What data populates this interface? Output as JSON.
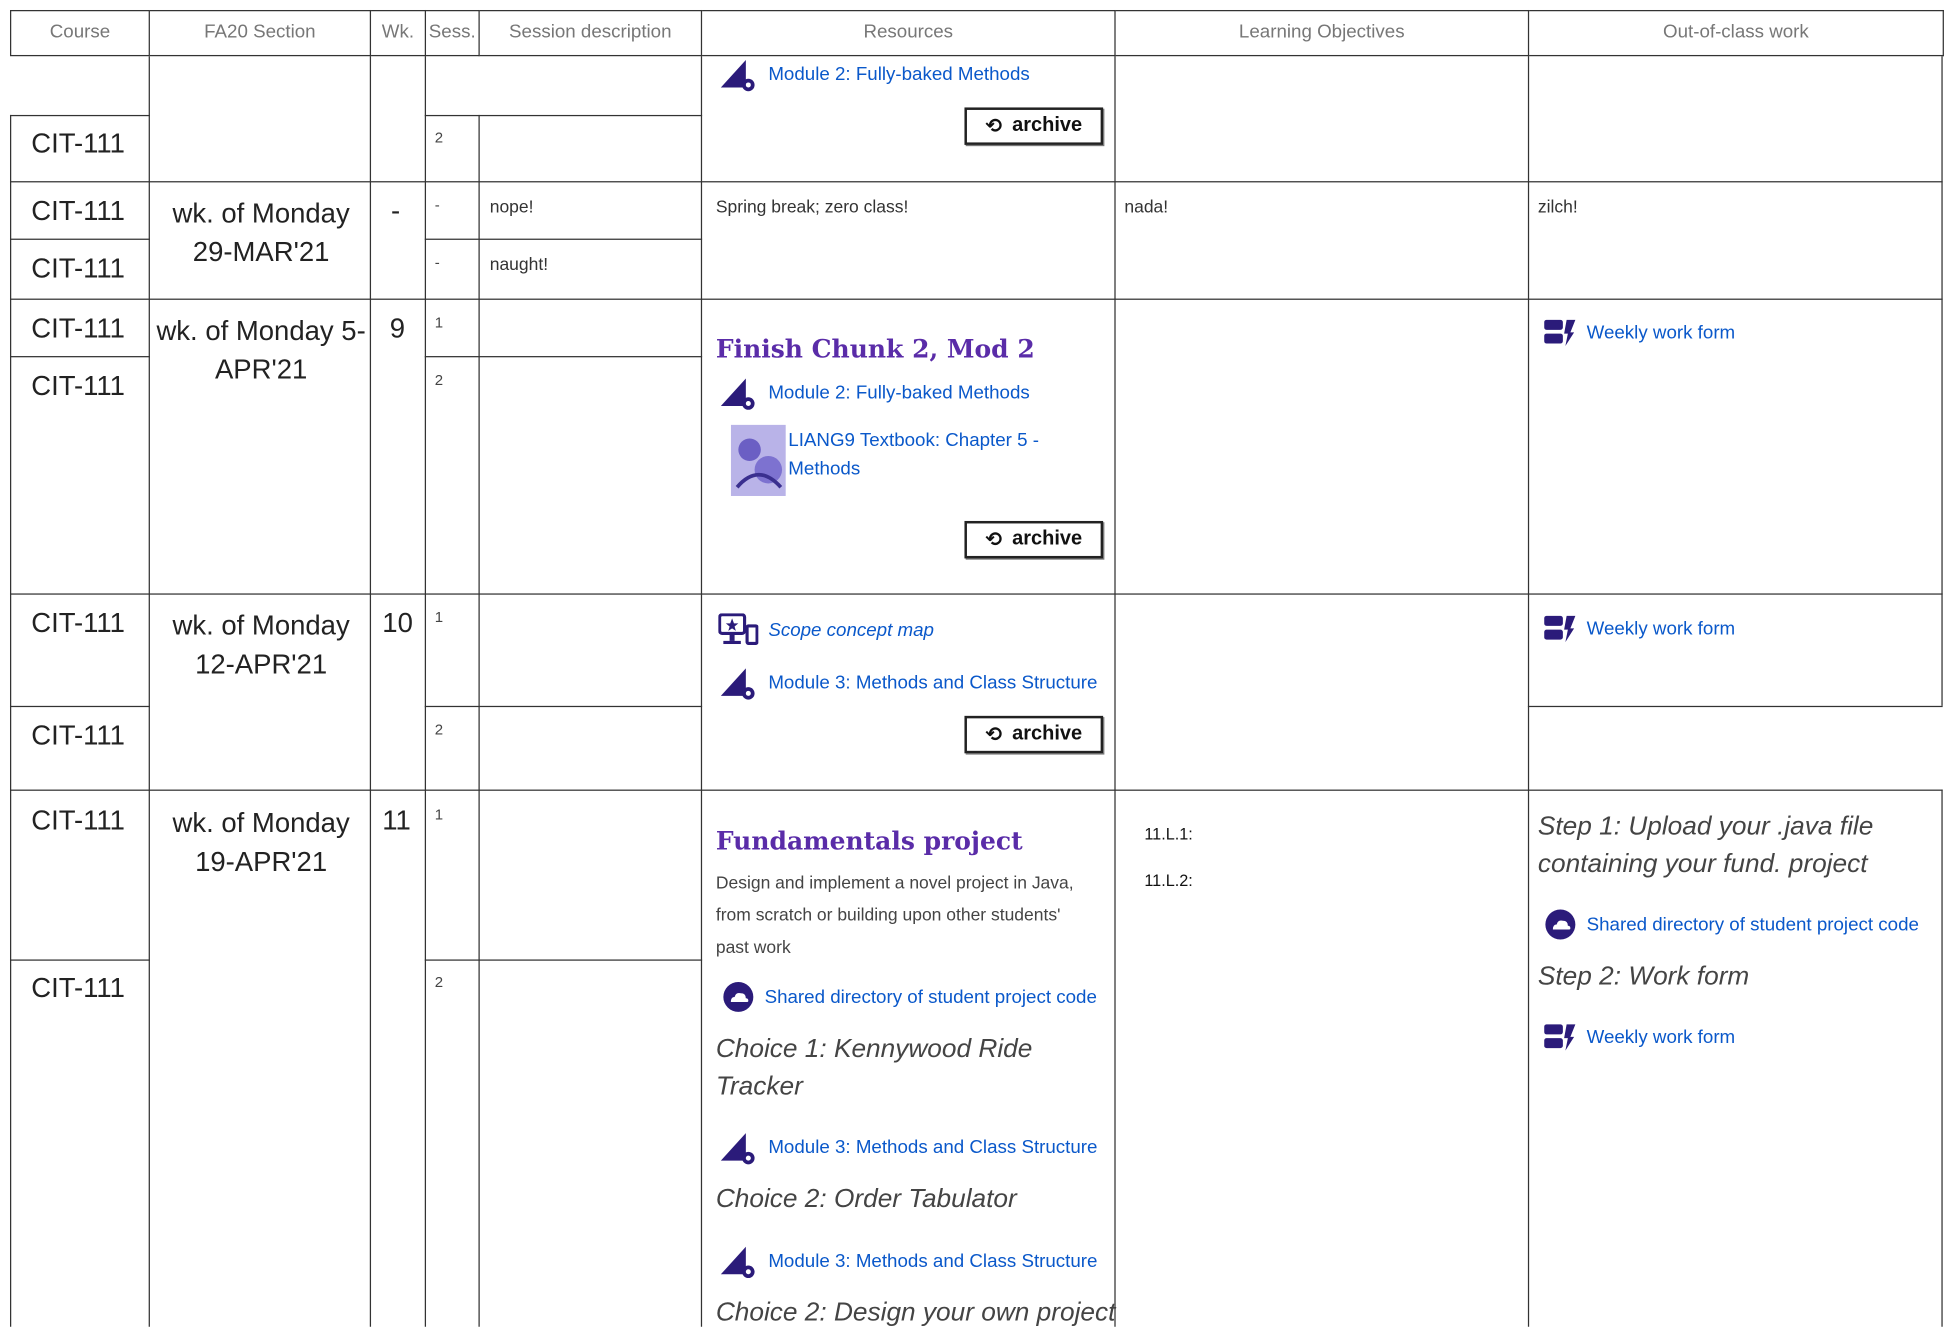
{
  "headers": [
    "Course",
    "FA20 Section",
    "Wk.",
    "Sess.",
    "Session description",
    "Resources",
    "Learning Objectives",
    "Out-of-class work"
  ],
  "top": {
    "course": "CIT-111",
    "sess": "2",
    "resource": "Module 2: Fully-baked Methods",
    "archive": "archive"
  },
  "spring": {
    "course1": "CIT-111",
    "course2": "CIT-111",
    "section": "wk. of Monday 29-MAR'21",
    "wk": "-",
    "sess1": "-",
    "sess2": "-",
    "desc1": "nope!",
    "desc2": "naught!",
    "resources": "Spring break; zero class!",
    "objectives": "nada!",
    "work": "zilch!"
  },
  "w9": {
    "course1": "CIT-111",
    "course2": "CIT-111",
    "section": "wk. of Monday 5-APR'21",
    "wk": "9",
    "sess1": "1",
    "sess2": "2",
    "title": "Finish Chunk 2, Mod 2",
    "res1": "Module 2: Fully-baked Methods",
    "res2": "LIANG9 Textbook: Chapter 5 - Methods",
    "archive": "archive",
    "work": "Weekly work form"
  },
  "w10": {
    "course1": "CIT-111",
    "course2": "CIT-111",
    "section": "wk. of Monday 12-APR'21",
    "wk": "10",
    "sess1": "1",
    "sess2": "2",
    "res1": "Scope concept map",
    "res2": "Module 3: Methods and Class Structure",
    "archive": "archive",
    "work": "Weekly work form"
  },
  "w11": {
    "course1": "CIT-111",
    "course2": "CIT-111",
    "section": "wk. of Monday 19-APR'21",
    "wk": "11",
    "sess1": "1",
    "sess2": "2",
    "title": "Fundamentals project",
    "desc": "Design and implement a novel project in Java, from scratch or building upon other students' past work",
    "shared": "Shared directory of student project code",
    "choice1": "Choice 1: Kennywood Ride Tracker",
    "choice1_res": "Module 3: Methods and Class Structure",
    "choice2": "Choice 2: Order Tabulator",
    "choice2_res": "Module 3: Methods and Class Structure",
    "choice3": "Choice 2: Design your own project",
    "obj1": "11.L.1:",
    "obj2": "11.L.2:",
    "step1": "Step 1: Upload your .java file containing your fund. project",
    "step1_res": "Shared directory of student project code",
    "step2": "Step 2: Work form",
    "step2_res": "Weekly work form"
  },
  "colors": {
    "link": "#0a58ca",
    "title": "#5a2ca8",
    "icon": "#2b1b7a"
  }
}
